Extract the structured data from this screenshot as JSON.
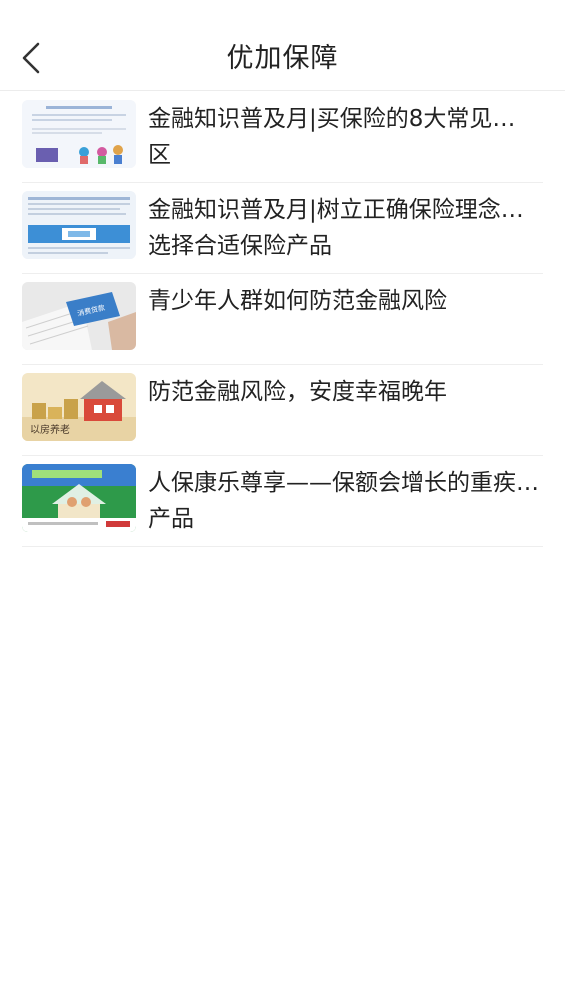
{
  "header": {
    "title": "优加保障",
    "back_icon": "chevron-left-icon"
  },
  "articles": [
    {
      "line1": "金融知识普及月|买保险的8大常见…",
      "line2": "区",
      "thumb": "financial-knowledge-poster-thumbnail"
    },
    {
      "line1": "金融知识普及月|树立正确保险理念…",
      "line2": "选择合适保险产品",
      "thumb": "insurance-concept-poster-thumbnail"
    },
    {
      "line1": "青少年人群如何防范金融风险",
      "line2": "",
      "thumb": "card-keyboard-photo-thumbnail",
      "thumb_text": "消费贷款"
    },
    {
      "line1": "防范金融风险，安度幸福晚年",
      "line2": "",
      "thumb": "house-coins-photo-thumbnail",
      "thumb_text": "以房养老"
    },
    {
      "line1": "人保康乐尊享——保额会增长的重疾…",
      "line2": "产品",
      "thumb": "health-insurance-poster-thumbnail"
    }
  ]
}
